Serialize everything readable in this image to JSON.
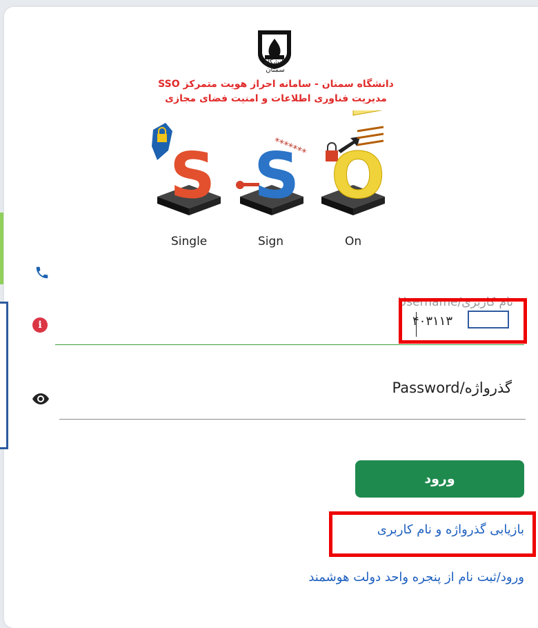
{
  "header": {
    "logo_caption": "دانشگاه سمنان",
    "line1": "دانشگاه سمنان - سامانه احراز هویت متمرکز SSO",
    "line2": "مدیریت فناوری اطلاعات و امنیت فضای مجازی"
  },
  "illustration": {
    "letters": [
      "S",
      "S",
      "O"
    ],
    "words": [
      "Single",
      "Sign",
      "On"
    ]
  },
  "form": {
    "username_label": "Username/نام کاربری",
    "username_value": "۴۰۳۱۱۳",
    "password_label": "Password/گذرواژه",
    "submit_label": "ورود"
  },
  "links": {
    "recover": "بازیابی گذرواژه و نام کاربری",
    "mygov": "ورود/ثبت نام از پنجره واحد دولت هوشمند"
  },
  "colors": {
    "heading": "#e12b2b",
    "button": "#1f8a4e",
    "link": "#1d5fbf",
    "highlight": "#ee0000"
  },
  "icons": [
    "phone-icon",
    "info-icon",
    "eye-icon",
    "university-logo"
  ]
}
